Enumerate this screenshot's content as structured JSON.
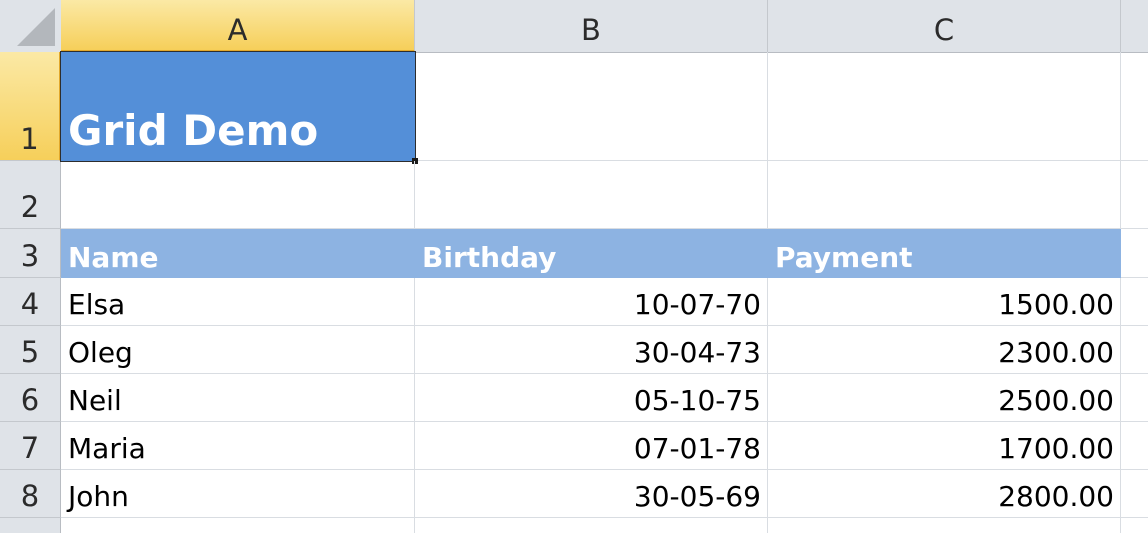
{
  "sheet": {
    "columns": [
      "A",
      "B",
      "C"
    ],
    "rows": [
      "1",
      "2",
      "3",
      "4",
      "5",
      "6",
      "7",
      "8"
    ],
    "title": "Grid Demo",
    "table_headers": [
      "Name",
      "Birthday",
      "Payment"
    ],
    "records": [
      [
        "Elsa",
        "10-07-70",
        "1500.00"
      ],
      [
        "Oleg",
        "30-04-73",
        "2300.00"
      ],
      [
        "Neil",
        "05-10-75",
        "2500.00"
      ],
      [
        "Maria",
        "07-01-78",
        "1700.00"
      ],
      [
        "John",
        "30-05-69",
        "2800.00"
      ]
    ],
    "selected_cell": "A1"
  },
  "colors": {
    "title_fill": "#548fd8",
    "header_fill": "#8db3e2",
    "selection_accent": "#f6cf5a"
  }
}
